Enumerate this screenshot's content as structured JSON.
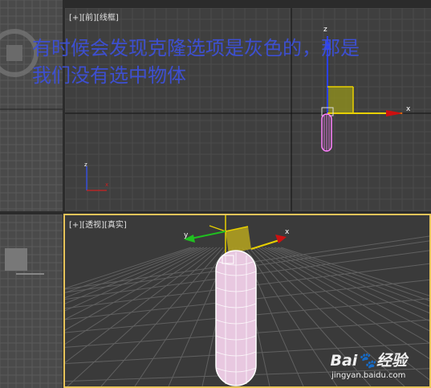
{
  "viewports": {
    "front": {
      "plus": "[+]",
      "view": "[前]",
      "shading": "[线框]"
    },
    "perspective": {
      "plus": "[+]",
      "view": "[透视]",
      "shading": "[真实]"
    }
  },
  "axes": {
    "x": "x",
    "y": "y",
    "z": "z"
  },
  "overlay": {
    "line1": "有时候会发现克隆选项是灰色的，那是",
    "line2": "我们没有选中物体"
  },
  "watermark": {
    "logo_left": "Bai",
    "logo_right": "经验",
    "url": "jingyan.baidu.com"
  },
  "colors": {
    "overlay_text": "#3d4fd0",
    "active_border": "#e8c45a",
    "gizmo_yellow": "#e8d000"
  }
}
